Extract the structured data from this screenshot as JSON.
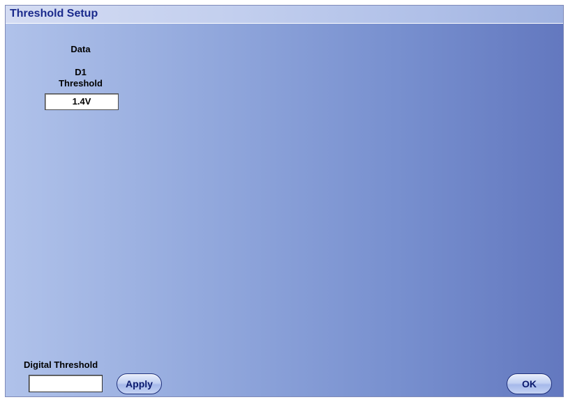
{
  "window": {
    "title": "Threshold Setup"
  },
  "data_section": {
    "heading": "Data",
    "channels": [
      {
        "name": "D1",
        "threshold_label": "Threshold",
        "threshold_value": "1.4V"
      }
    ]
  },
  "digital_threshold": {
    "label": "Digital Threshold",
    "value": "",
    "apply_label": "Apply"
  },
  "ok_label": "OK",
  "colors": {
    "title_text": "#1a2a8c",
    "panel_gradient_start": "#b0c2ea",
    "panel_gradient_end": "#6378bf",
    "button_text": "#0b1a6e"
  }
}
